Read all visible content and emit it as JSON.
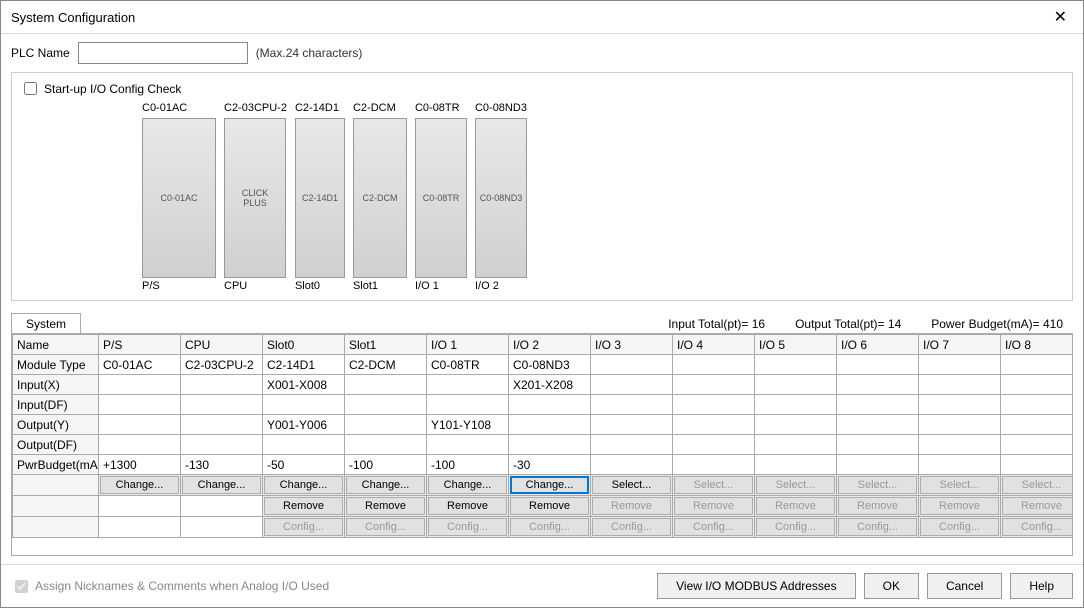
{
  "window": {
    "title": "System Configuration"
  },
  "plc": {
    "label": "PLC Name",
    "value": "",
    "hint": "(Max.24 characters)"
  },
  "startup_check": {
    "label": "Start-up I/O Config Check",
    "checked": false
  },
  "modules": {
    "headers": [
      "C0-01AC",
      "C2-03CPU-2",
      "C2-14D1",
      "C2-DCM",
      "C0-08TR",
      "C0-08ND3"
    ],
    "footers": [
      "P/S",
      "CPU",
      "Slot0",
      "Slot1",
      "I/O 1",
      "I/O 2"
    ]
  },
  "tab": "System",
  "totals": {
    "input": "Input Total(pt)= 16",
    "output": "Output Total(pt)= 14",
    "power": "Power Budget(mA)= 410"
  },
  "table": {
    "headers": [
      "Name",
      "P/S",
      "CPU",
      "Slot0",
      "Slot1",
      "I/O 1",
      "I/O 2",
      "I/O 3",
      "I/O 4",
      "I/O 5",
      "I/O 6",
      "I/O 7",
      "I/O 8"
    ],
    "rows": [
      {
        "name": "Module Type",
        "cells": [
          "C0-01AC",
          "C2-03CPU-2",
          "C2-14D1",
          "C2-DCM",
          "C0-08TR",
          "C0-08ND3",
          "",
          "",
          "",
          "",
          "",
          ""
        ]
      },
      {
        "name": "Input(X)",
        "cells": [
          "",
          "",
          "X001-X008",
          "",
          "",
          "X201-X208",
          "",
          "",
          "",
          "",
          "",
          ""
        ]
      },
      {
        "name": "Input(DF)",
        "cells": [
          "",
          "",
          "",
          "",
          "",
          "",
          "",
          "",
          "",
          "",
          "",
          ""
        ]
      },
      {
        "name": "Output(Y)",
        "cells": [
          "",
          "",
          "Y001-Y006",
          "",
          "Y101-Y108",
          "",
          "",
          "",
          "",
          "",
          "",
          ""
        ]
      },
      {
        "name": "Output(DF)",
        "cells": [
          "",
          "",
          "",
          "",
          "",
          "",
          "",
          "",
          "",
          "",
          "",
          ""
        ]
      },
      {
        "name": "PwrBudget(mA)",
        "cells": [
          "+1300",
          "-130",
          "-50",
          "-100",
          "-100",
          "-30",
          "",
          "",
          "",
          "",
          "",
          ""
        ]
      }
    ],
    "btn": {
      "change": "Change...",
      "select": "Select...",
      "remove": "Remove",
      "config": "Config..."
    }
  },
  "footer": {
    "assign": "Assign Nicknames & Comments when Analog I/O Used",
    "view": "View I/O MODBUS Addresses",
    "ok": "OK",
    "cancel": "Cancel",
    "help": "Help"
  }
}
